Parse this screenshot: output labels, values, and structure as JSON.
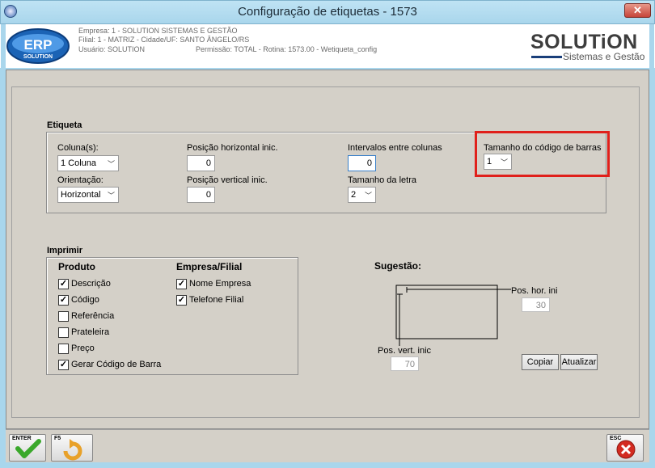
{
  "window": {
    "title": "Configuração de etiquetas - 1573",
    "close_glyph": "✕"
  },
  "header": {
    "empresa": "Empresa: 1 - SOLUTION SISTEMAS E GESTÃO",
    "filial": "Filial: 1 - MATRIZ - Cidade/UF: SANTO ÂNGELO/RS",
    "usuario": "Usuário: SOLUTION",
    "permissao": "Permissão: TOTAL - Rotina: 1573.00 - Wetiqueta_config",
    "logo_left": "ERP",
    "logo_left_sub": "SOLUTION",
    "logo_right": "SOLUTiON",
    "logo_right_sub": "Sistemas e Gestão"
  },
  "etiqueta": {
    "title": "Etiqueta",
    "coluna_label": "Coluna(s):",
    "coluna_value": "1 Coluna",
    "orientacao_label": "Orientação:",
    "orientacao_value": "Horizontal",
    "pos_horizontal_label": "Posição horizontal inic.",
    "pos_horizontal_value": "0",
    "pos_vertical_label": "Posição vertical inic.",
    "pos_vertical_value": "0",
    "intervalos_label": "Intervalos entre colunas",
    "intervalos_value": "0",
    "tamanho_letra_label": "Tamanho da letra",
    "tamanho_letra_value": "2",
    "tamanho_barras_label": "Tamanho do código de barras",
    "tamanho_barras_value": "1"
  },
  "imprimir": {
    "title": "Imprimir",
    "produto_header": "Produto",
    "empresa_header": "Empresa/Filial",
    "produto_items": [
      {
        "label": "Descrição",
        "checked": true
      },
      {
        "label": "Código",
        "checked": true
      },
      {
        "label": "Referência",
        "checked": false
      },
      {
        "label": "Prateleira",
        "checked": false
      },
      {
        "label": "Preço",
        "checked": false
      },
      {
        "label": "Gerar Código de Barra",
        "checked": true
      }
    ],
    "empresa_items": [
      {
        "label": "Nome Empresa",
        "checked": true
      },
      {
        "label": "Telefone Filial",
        "checked": true
      }
    ]
  },
  "sugestao": {
    "title": "Sugestão:",
    "pos_hor_label": "Pos. hor. ini",
    "pos_hor_value": "30",
    "pos_vert_label": "Pos. vert. inic",
    "pos_vert_value": "70",
    "copiar_label": "Copiar",
    "atualizar_label": "Atualizar"
  },
  "footer": {
    "enter_key": "ENTER",
    "f5_key": "F5",
    "esc_key": "ESC"
  },
  "colors": {
    "highlight": "#e0201b",
    "titlebar": "#a9d6ec",
    "panel": "#d4d0c8"
  }
}
